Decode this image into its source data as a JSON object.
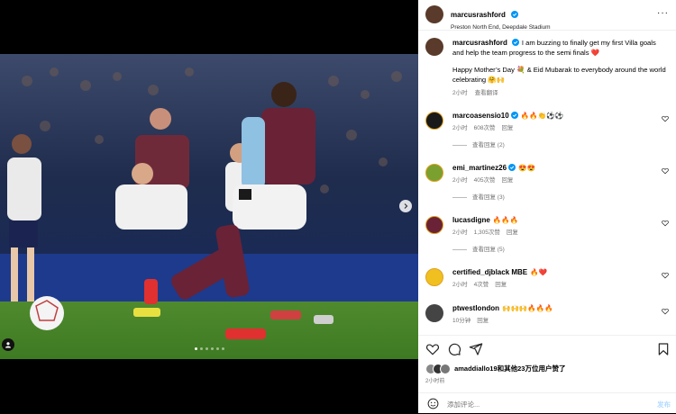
{
  "header": {
    "username": "marcusrashford",
    "location": "Preston North End, Deepdale Stadium",
    "more_icon": "more-horizontal-icon"
  },
  "caption": {
    "username": "marcusrashford",
    "text_line1": "I am buzzing to finally get my first Villa goals and help the team progress to the semi finals ❤️",
    "text_line2": "Happy Mother’s Day 💐 & Eid Mubarak to everybody around the world celebrating 🤗🙌",
    "time": "2小时",
    "translate": "查看翻译"
  },
  "comments": [
    {
      "username": "marcoasensio10",
      "text": "🔥🔥👏⚽⚽",
      "time": "2小时",
      "likes": "608次赞",
      "reply": "回复",
      "view_replies": "查看回复 (2)"
    },
    {
      "username": "emi_martinez26",
      "text": "😍😍",
      "time": "2小时",
      "likes": "405次赞",
      "reply": "回复",
      "view_replies": "查看回复 (3)"
    },
    {
      "username": "lucasdigne",
      "text": "🔥🔥🔥",
      "time": "2小时",
      "likes": "1,305次赞",
      "reply": "回复",
      "view_replies": "查看回复 (5)"
    },
    {
      "username": "certified_djblack MBE",
      "text": "🔥❤️",
      "time": "2小时",
      "likes": "4次赞",
      "reply": "回复"
    },
    {
      "username": "ptwestlondon",
      "text": "🙌🙌🙌🔥🔥🔥",
      "time": "10分钟",
      "reply": "回复"
    }
  ],
  "likes": {
    "user": "amaddiallo19",
    "text": "和其他23万位用户赞了"
  },
  "post_time": "2小时前",
  "add_comment": {
    "placeholder": "添加评论...",
    "post_label": "发布"
  },
  "carousel": {
    "slides": 6,
    "active": 1
  },
  "colors": {
    "verified": "#0095f6",
    "heart": "#ff3040",
    "post_button": "#b3dbff"
  }
}
